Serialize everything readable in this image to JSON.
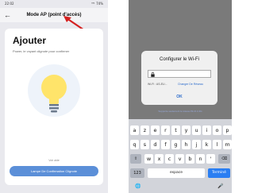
{
  "left": {
    "status": {
      "time": "22:02",
      "right": "⁸⁶ᴸ 74%"
    },
    "nav": {
      "title": "Mode AP (point d'accès)"
    },
    "card": {
      "title": "Ajouter",
      "subtitle": "Power, le voyant clignote pour confirmer"
    },
    "link_text": "Voir aide",
    "confirm_button": "Lampe De Confirmation Clignote",
    "colors": {
      "arrow": "#d42020",
      "bulb": "#ffe46a",
      "button": "#5b8fd8"
    }
  },
  "right": {
    "dialog": {
      "title": "Configurer le Wi-Fi",
      "ssid": "Wi-Fi : AS-EU...",
      "change": "Changer De Réseau",
      "ok": "OK"
    },
    "note": "Supporte seulement le réseau Wi-Fi 2.4G",
    "keyboard": {
      "row1": [
        "a",
        "z",
        "e",
        "r",
        "t",
        "y",
        "u",
        "i",
        "o",
        "p"
      ],
      "row2": [
        "q",
        "s",
        "d",
        "f",
        "g",
        "h",
        "j",
        "k",
        "l",
        "m"
      ],
      "row3": [
        "w",
        "x",
        "c",
        "v",
        "b",
        "n",
        "'"
      ],
      "shift": "⇧",
      "backspace": "⌫",
      "numbers": "123",
      "space": "espace",
      "enter": "Terminé",
      "globe": "🌐",
      "mic": "🎤"
    }
  }
}
